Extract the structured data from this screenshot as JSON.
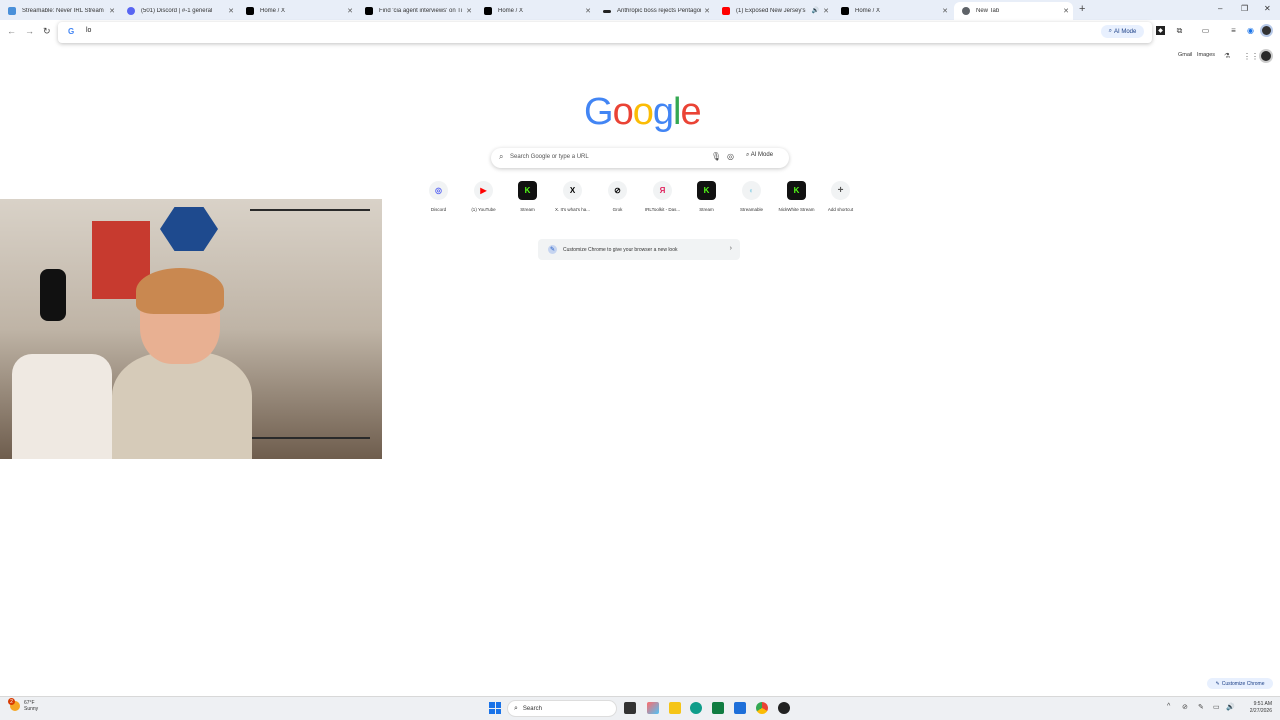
{
  "tabs": [
    {
      "title": "Streamable: Never IRL Stream Ha",
      "color": "#4a90d9"
    },
    {
      "title": "(501) Discord | #-1 general",
      "color": "#5865f2"
    },
    {
      "title": "Home / X",
      "color": "#000000"
    },
    {
      "title": "Find 'cia agent interviews' on Ti",
      "color": "#000000"
    },
    {
      "title": "Home / X",
      "color": "#000000"
    },
    {
      "title": "Anthropic boss rejects Pentagon",
      "color": "#222222"
    },
    {
      "title": "(1) Exposed New Jersey's",
      "color": "#ff0000"
    },
    {
      "title": "Home / X",
      "color": "#000000"
    },
    {
      "title": "New Tab",
      "color": "#5f6368"
    }
  ],
  "omnibox": {
    "typed": "lo"
  },
  "toolbar": {
    "ai_mode": "AI Mode"
  },
  "ntp": {
    "links": {
      "gmail": "Gmail",
      "images": "Images"
    },
    "logo": [
      "G",
      "o",
      "o",
      "g",
      "l",
      "e"
    ],
    "search": {
      "placeholder": "Search Google or type a URL",
      "ai_mode": "AI Mode"
    },
    "shortcuts": [
      {
        "label": "Discord",
        "glyph": "◎",
        "color": "#5865f2"
      },
      {
        "label": "(1) YouTube",
        "glyph": "▶",
        "color": "#ff0000"
      },
      {
        "label": "Stream",
        "glyph": "K",
        "color": "#53fc18"
      },
      {
        "label": "X. It's what's ha...",
        "glyph": "X",
        "color": "#000000"
      },
      {
        "label": "Grok",
        "glyph": "⊘",
        "color": "#000000"
      },
      {
        "label": "IRLToolkit - Das...",
        "glyph": "Я",
        "color": "#e0245e"
      },
      {
        "label": "Stream",
        "glyph": "K",
        "color": "#53fc18"
      },
      {
        "label": "Streamable",
        "glyph": "◐",
        "color": "#9fd6e8"
      },
      {
        "label": "NickWhite Stream",
        "glyph": "K",
        "color": "#53fc18"
      },
      {
        "label": "Add shortcut",
        "glyph": "+",
        "color": "#555555"
      }
    ],
    "customize_card": "Customize Chrome to give your browser a new look",
    "customize_button": "Customize Chrome"
  },
  "taskbar": {
    "weather": {
      "temp": "67°F",
      "condition": "Sunny",
      "badge": "2"
    },
    "search": "Search",
    "time": "9:51 AM",
    "date": "2/27/2026"
  }
}
